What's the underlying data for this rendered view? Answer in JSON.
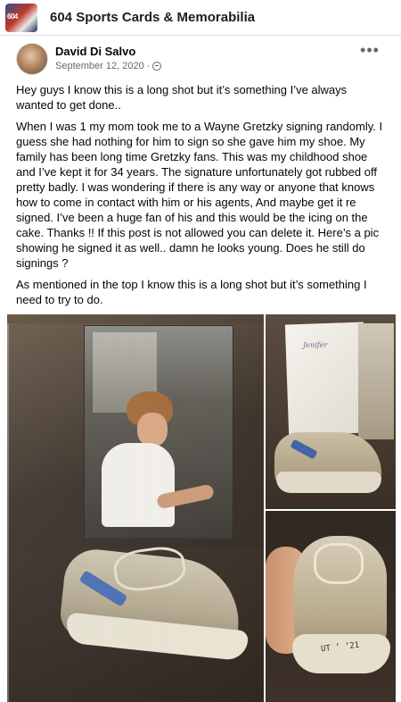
{
  "group": {
    "title": "604 Sports Cards & Memorabilia",
    "thumb_label": "604"
  },
  "post": {
    "author": "David Di Salvo",
    "date": "September 12, 2020",
    "date_separator": "·",
    "more_label": "•••",
    "paragraphs": [
      "Hey guys I know this is a long shot but it’s something I’ve always wanted to get done..",
      "When I was 1 my mom took me to a Wayne Gretzky signing randomly. I guess she had nothing for him to sign so she gave him my shoe. My family has been long time Gretzky fans. This was my childhood shoe and I’ve kept it for 34 years. The signature unfortunately got rubbed off pretty badly. I was wondering if there is any way or anyone  that knows how to come in contact with him or his agents, And maybe get it re signed. I’ve been a huge fan of his and this would be the icing on the cake. Thanks !! If this post is not allowed you can delete it. Here’s a pic showing he signed it as well.. damn he looks young. Does he still do signings ?",
      "As mentioned in the top I know this is a long shot but it’s something I need to try to do."
    ]
  },
  "photos": {
    "paper_signature": "Jenifer",
    "shoe_writing": "UT ’ ’21"
  },
  "colors": {
    "background": "#f0f2f5",
    "card": "#ffffff",
    "secondary_text": "#65676b",
    "shoe_stripe": "#4a6db3"
  }
}
